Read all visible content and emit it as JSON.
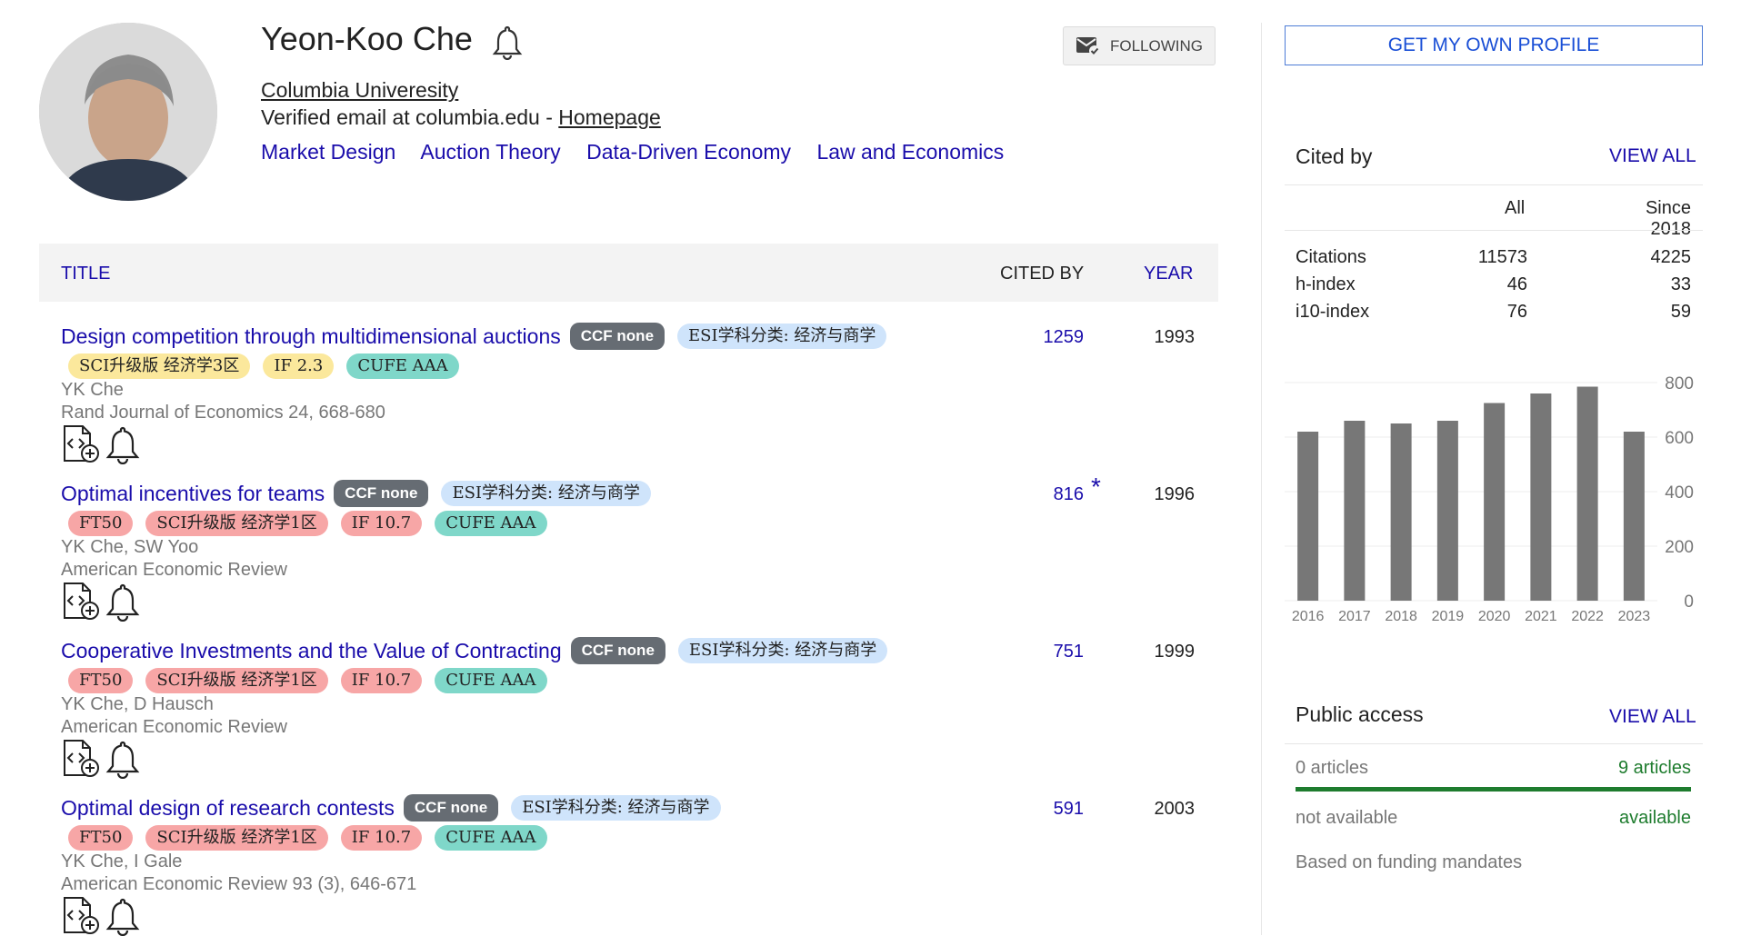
{
  "profile": {
    "name": "Yeon-Koo Che",
    "affiliation": "Columbia Univeresity",
    "email_prefix": "Verified email at columbia.edu - ",
    "homepage": "Homepage",
    "interests": [
      "Market Design",
      "Auction Theory",
      "Data-Driven Economy",
      "Law and Economics"
    ],
    "follow_label": "FOLLOWING"
  },
  "table": {
    "col_title": "TITLE",
    "col_cited": "CITED BY",
    "col_year": "YEAR"
  },
  "articles": [
    {
      "title": "Design competition through multidimensional auctions",
      "badges_line1": [
        "CCF none",
        "ESI学科分类: 经济与商学"
      ],
      "badges_line2": [
        "SCI升级版 经济学3区",
        "IF 2.3",
        "CUFE AAA"
      ],
      "authors": "YK Che",
      "venue": "Rand Journal of Economics 24, 668-680",
      "cited": "1259",
      "star": "",
      "year": "1993"
    },
    {
      "title": "Optimal incentives for teams",
      "badges_line1": [
        "CCF none",
        "ESI学科分类: 经济与商学"
      ],
      "badges_line2": [
        "FT50",
        "SCI升级版 经济学1区",
        "IF 10.7",
        "CUFE AAA"
      ],
      "authors": "YK Che, SW Yoo",
      "venue": "American Economic Review",
      "cited": "816",
      "star": "*",
      "year": "1996"
    },
    {
      "title": "Cooperative Investments and the Value of Contracting",
      "badges_line1": [
        "CCF none",
        "ESI学科分类: 经济与商学"
      ],
      "badges_line2": [
        "FT50",
        "SCI升级版 经济学1区",
        "IF 10.7",
        "CUFE AAA"
      ],
      "authors": "YK Che, D Hausch",
      "venue": "American Economic Review",
      "cited": "751",
      "star": "",
      "year": "1999"
    },
    {
      "title": "Optimal design of research contests",
      "badges_line1": [
        "CCF none",
        "ESI学科分类: 经济与商学"
      ],
      "badges_line2": [
        "FT50",
        "SCI升级版 经济学1区",
        "IF 10.7",
        "CUFE AAA"
      ],
      "authors": "YK Che, I Gale",
      "venue": "American Economic Review 93 (3), 646-671",
      "cited": "591",
      "star": "",
      "year": "2003"
    }
  ],
  "sidebar": {
    "get_profile": "GET MY OWN PROFILE",
    "cited_by": "Cited by",
    "view_all": "VIEW ALL",
    "col_all": "All",
    "col_since": "Since 2018",
    "stats": [
      {
        "label": "Citations",
        "all": "11573",
        "since": "4225"
      },
      {
        "label": "h-index",
        "all": "46",
        "since": "33"
      },
      {
        "label": "i10-index",
        "all": "76",
        "since": "59"
      }
    ],
    "public_access": "Public access",
    "pa_view_all": "VIEW ALL",
    "pa_left": "0 articles",
    "pa_right": "9 articles",
    "pa_left_sub": "not available",
    "pa_right_sub": "available",
    "pa_note": "Based on funding mandates",
    "pa_available_fraction": 1.0,
    "bar_color": "#777777",
    "pa_bar_color": "#1e7c2e"
  },
  "chart_data": {
    "type": "bar",
    "categories": [
      "2016",
      "2017",
      "2018",
      "2019",
      "2020",
      "2021",
      "2022",
      "2023"
    ],
    "values": [
      620,
      660,
      650,
      660,
      725,
      760,
      785,
      620
    ],
    "ylim": [
      0,
      800
    ],
    "yticks": [
      "800",
      "600",
      "400",
      "200",
      "0"
    ],
    "grid": true
  }
}
